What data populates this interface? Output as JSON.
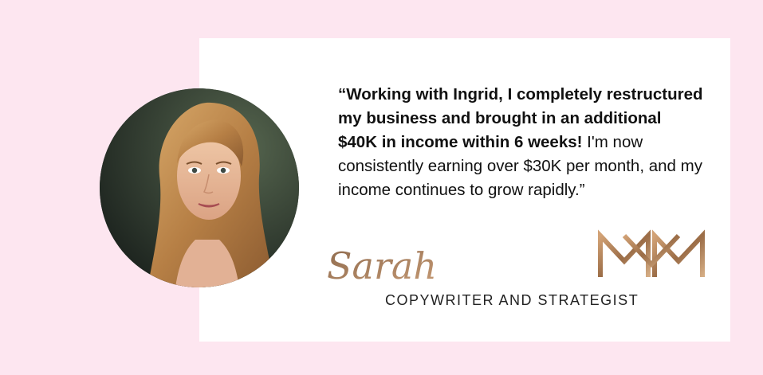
{
  "testimonial": {
    "quote_bold": "“Working with Ingrid, I completely restructured my business and brought in an additional $40K in income within 6 weeks!",
    "quote_regular": " I'm now consistently earning over $30K per month, and my income continues to grow rapidly.”",
    "signature": "Sarah",
    "role": "COPYWRITER AND STRATEGIST"
  },
  "colors": {
    "page_background": "#fde6f0",
    "card_background": "#ffffff",
    "accent_gold": "#b9885e"
  },
  "icons": {
    "logo": "gold-monogram-logo",
    "photo": "woman-portrait"
  }
}
